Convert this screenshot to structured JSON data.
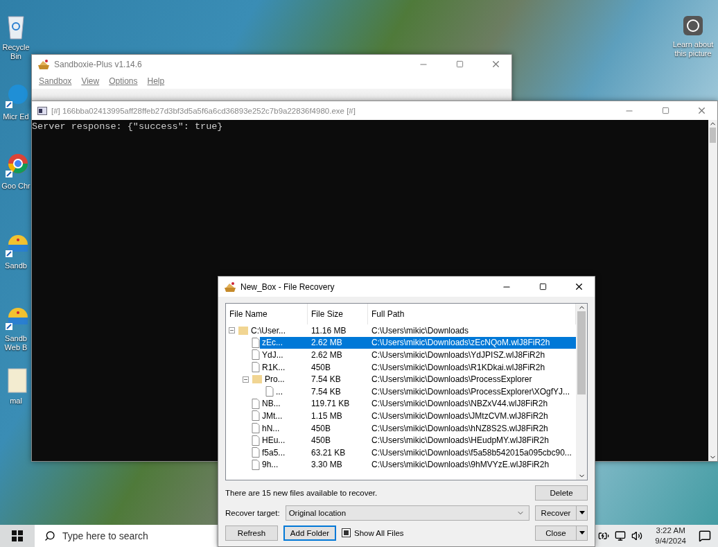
{
  "desktop": {
    "icons": [
      {
        "kind": "recycle",
        "label": "Recycle Bin"
      },
      {
        "kind": "edge",
        "label": "Micr Ed"
      },
      {
        "kind": "chrome",
        "label": "Goo Chr"
      },
      {
        "kind": "sandbox",
        "label": "Sandb"
      },
      {
        "kind": "sandbox",
        "label": "Sandb Web B"
      },
      {
        "kind": "file",
        "label": "mal"
      }
    ],
    "spotlight": {
      "label": "Learn about this picture"
    }
  },
  "main_window": {
    "title": "Sandboxie-Plus v1.14.6",
    "menu": [
      "Sandbox",
      "View",
      "Options",
      "Help"
    ]
  },
  "console": {
    "title": "[#] 166bba02413995aff28ffeb27d3bf3d5a5f6a6cd36893e252c7b9a22836f4980.exe [#]",
    "lines": [
      "Server response: {\"success\": true}"
    ]
  },
  "dialog": {
    "title": "New_Box - File Recovery",
    "columns": [
      "File Name",
      "File Size",
      "Full Path"
    ],
    "tree": [
      {
        "kind": "folder",
        "expanded": true,
        "selected": false,
        "name": "C:\\User...",
        "size": "11.16 MB",
        "path": "C:\\Users\\mikic\\Downloads",
        "children": [
          {
            "kind": "file",
            "selected": true,
            "name": "zEc...",
            "size": "2.62 MB",
            "path": "C:\\Users\\mikic\\Downloads\\zEcNQoM.wlJ8FiR2h"
          },
          {
            "kind": "file",
            "selected": false,
            "name": "YdJ...",
            "size": "2.62 MB",
            "path": "C:\\Users\\mikic\\Downloads\\YdJPISZ.wlJ8FiR2h"
          },
          {
            "kind": "file",
            "selected": false,
            "name": "R1K...",
            "size": "450B",
            "path": "C:\\Users\\mikic\\Downloads\\R1KDkai.wlJ8FiR2h"
          },
          {
            "kind": "folder",
            "expanded": true,
            "selected": false,
            "name": "Pro...",
            "size": "7.54 KB",
            "path": "C:\\Users\\mikic\\Downloads\\ProcessExplorer",
            "children": [
              {
                "kind": "file",
                "selected": false,
                "name": "...",
                "size": "7.54 KB",
                "path": "C:\\Users\\mikic\\Downloads\\ProcessExplorer\\XOgfYJ..."
              }
            ]
          },
          {
            "kind": "file",
            "selected": false,
            "name": "NB...",
            "size": "119.71 KB",
            "path": "C:\\Users\\mikic\\Downloads\\NBZxV44.wlJ8FiR2h"
          },
          {
            "kind": "file",
            "selected": false,
            "name": "JMt...",
            "size": "1.15 MB",
            "path": "C:\\Users\\mikic\\Downloads\\JMtzCVM.wlJ8FiR2h"
          },
          {
            "kind": "file",
            "selected": false,
            "name": "hN...",
            "size": "450B",
            "path": "C:\\Users\\mikic\\Downloads\\hNZ8S2S.wlJ8FiR2h"
          },
          {
            "kind": "file",
            "selected": false,
            "name": "HEu...",
            "size": "450B",
            "path": "C:\\Users\\mikic\\Downloads\\HEudpMY.wlJ8FiR2h"
          },
          {
            "kind": "file",
            "selected": false,
            "name": "f5a5...",
            "size": "63.21 KB",
            "path": "C:\\Users\\mikic\\Downloads\\f5a58b542015a095cbc90..."
          },
          {
            "kind": "file",
            "selected": false,
            "name": "9h...",
            "size": "3.30 MB",
            "path": "C:\\Users\\mikic\\Downloads\\9hMVYzE.wlJ8FiR2h"
          }
        ]
      }
    ],
    "status": "There are 15 new files available to recover.",
    "delete_button": "Delete",
    "recover_target": {
      "label": "Recover target:",
      "value": "Original location"
    },
    "recover_button": "Recover",
    "refresh_button": "Refresh",
    "add_folder_button": "Add Folder",
    "show_all_files": {
      "label": "Show All Files",
      "checked": true
    },
    "close_button": "Close"
  },
  "taskbar": {
    "search": {
      "placeholder": "Type here to search"
    },
    "time": "3:22 AM",
    "date": "9/4/2024"
  }
}
